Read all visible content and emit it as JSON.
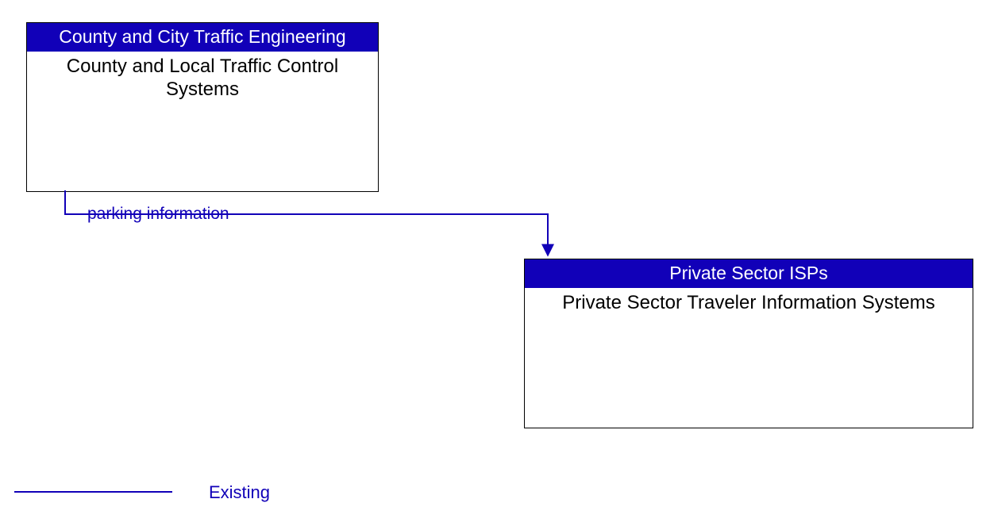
{
  "box1": {
    "header": "County and City Traffic Engineering",
    "body": "County and Local Traffic Control Systems"
  },
  "box2": {
    "header": "Private Sector ISPs",
    "body": "Private Sector Traveler Information Systems"
  },
  "flow": {
    "label": "parking information"
  },
  "legend": {
    "label": "Existing"
  }
}
